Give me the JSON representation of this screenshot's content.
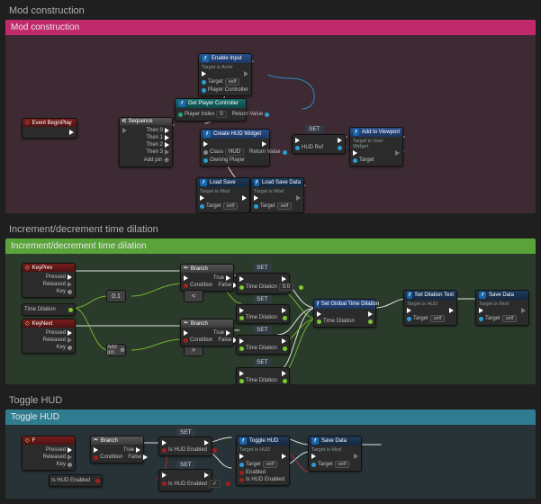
{
  "sections": {
    "mod": {
      "label": "Mod construction",
      "header": "Mod construction",
      "nodes": {
        "beginplay": {
          "title": "Event BeginPlay"
        },
        "sequence": {
          "title": "Sequence",
          "pins": {
            "then0": "Then 0",
            "then1": "Then 1",
            "then2": "Then 2",
            "then3": "Then 3",
            "addpin": "Add pin"
          }
        },
        "enableinput": {
          "title": "Enable Input",
          "subtitle": "Target is Actor",
          "pins": {
            "target": "Target",
            "self": "self",
            "pc": "Player Controller"
          }
        },
        "getpc": {
          "title": "Get Player Controller",
          "pins": {
            "idx": "Player Index",
            "idxval": "0",
            "rv": "Return Value"
          }
        },
        "createwidget": {
          "title": "Create HUD Widget",
          "pins": {
            "class": "Class",
            "classval": "HUD",
            "owner": "Owning Player",
            "rv": "Return Value"
          }
        },
        "set_hudref": {
          "label": "SET",
          "pin": "HUD Ref"
        },
        "addvp": {
          "title": "Add to Viewport",
          "subtitle": "Target is User Widget",
          "pins": {
            "target": "Target"
          }
        },
        "loadsave": {
          "title": "Load Save",
          "subtitle": "Target is Mod",
          "pins": {
            "target": "Target",
            "self": "self"
          }
        },
        "loadsavedata": {
          "title": "Load Save Data",
          "subtitle": "Target is Mod",
          "pins": {
            "target": "Target",
            "self": "self"
          }
        }
      }
    },
    "inc": {
      "label": "Increment/decrement time dilation",
      "header": "Increment/decrement time dilation",
      "nodes": {
        "keyprev": {
          "title": "KeyPrev",
          "pins": {
            "pressed": "Pressed",
            "released": "Released",
            "key": "Key"
          }
        },
        "keynext": {
          "title": "KeyNext",
          "pins": {
            "pressed": "Pressed",
            "released": "Released",
            "key": "Key"
          }
        },
        "const01": "0.1",
        "branch_top": {
          "title": "Branch",
          "pins": {
            "cond": "Condition",
            "true": "True",
            "false": "False"
          }
        },
        "branch_bot": {
          "title": "Branch",
          "pins": {
            "cond": "Condition",
            "true": "True",
            "false": "False"
          }
        },
        "set_top": {
          "label": "SET",
          "pin": "Time Dilation",
          "val": "0.0"
        },
        "set_bot": {
          "label": "SET",
          "pin": "Time Dilation"
        },
        "set_mid": {
          "label": "SET",
          "pin": "Time Dilation"
        },
        "getglobal": {
          "title": "Set Global Time Dilation",
          "pins": {
            "td": "Time Dilation"
          }
        },
        "setdiltext": {
          "title": "Set Dilation Text",
          "subtitle": "Target is HUD",
          "pins": {
            "target": "Target",
            "self": "self"
          }
        },
        "savedata": {
          "title": "Save Data",
          "subtitle": "Target is Mod",
          "pins": {
            "target": "Target",
            "self": "self"
          }
        },
        "addpin": "Add pin"
      }
    },
    "tog": {
      "label": "Toggle HUD",
      "header": "Toggle HUD",
      "nodes": {
        "event": {
          "title": "F",
          "pins": {
            "pressed": "Pressed",
            "released": "Released",
            "key": "Key"
          }
        },
        "branch": {
          "title": "Branch",
          "pins": {
            "cond": "Condition",
            "true": "True",
            "false": "False"
          }
        },
        "ishud": "Is HUD Enabled",
        "set_true": {
          "label": "SET",
          "pin": "Is HUD Enabled"
        },
        "set_false": {
          "label": "SET",
          "pin": "Is HUD Enabled"
        },
        "togglehud": {
          "title": "Toggle HUD",
          "subtitle": "Target is HUD",
          "pins": {
            "target": "Target",
            "self": "self",
            "enabled": "Enabled",
            "ishud": "Is HUD Enabled"
          }
        },
        "savedata": {
          "title": "Save Data",
          "subtitle": "Target is Mod",
          "pins": {
            "target": "Target",
            "self": "self"
          }
        }
      }
    }
  }
}
